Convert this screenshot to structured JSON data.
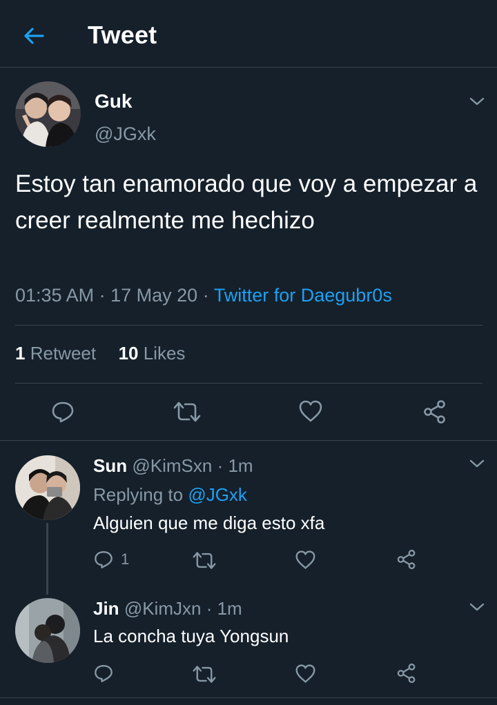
{
  "header": {
    "title": "Tweet",
    "back_icon": "arrow-left-icon",
    "accent": "#1da1f2"
  },
  "tweet": {
    "author_name": "Guk",
    "author_handle": "@JGxk",
    "text": "Estoy tan enamorado que voy a empezar a creer realmente me hechizo",
    "time": "01:35 AM",
    "date": "17 May 20",
    "source": "Twitter for Daegubr0s",
    "retweet_count": "1",
    "retweet_label": "Retweet",
    "like_count": "10",
    "like_label": "Likes"
  },
  "replies": [
    {
      "name": "Sun",
      "handle": "@KimSxn",
      "time": "1m",
      "replying_label": "Replying to",
      "replying_to": "@JGxk",
      "text": "Alguien que me diga esto xfa",
      "reply_count": "1"
    },
    {
      "name": "Jin",
      "handle": "@KimJxn",
      "time": "1m",
      "text": "La concha tuya Yongsun"
    }
  ],
  "colors": {
    "background": "#15202b",
    "secondary_text": "#8899a6",
    "divider": "#38444d",
    "link": "#1da1f2"
  },
  "separators": {
    "dot": "·"
  }
}
